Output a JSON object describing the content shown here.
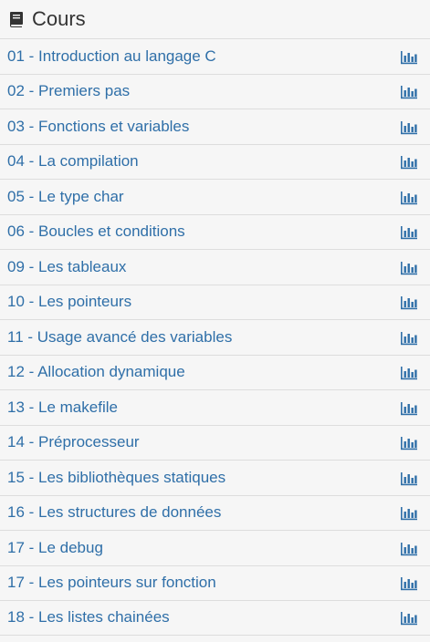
{
  "header": {
    "title": "Cours",
    "icon": "book-icon"
  },
  "colors": {
    "link": "#2f6fa8",
    "icon": "#2f6fa8",
    "title": "#333333",
    "divider": "#dddddd",
    "background": "#f6f6f6"
  },
  "items": [
    {
      "label": "01 - Introduction au langage C",
      "icon": "bar-chart-icon"
    },
    {
      "label": "02 - Premiers pas",
      "icon": "bar-chart-icon"
    },
    {
      "label": "03 - Fonctions et variables",
      "icon": "bar-chart-icon"
    },
    {
      "label": "04 - La compilation",
      "icon": "bar-chart-icon"
    },
    {
      "label": "05 - Le type char",
      "icon": "bar-chart-icon"
    },
    {
      "label": "06 - Boucles et conditions",
      "icon": "bar-chart-icon"
    },
    {
      "label": "09 - Les tableaux",
      "icon": "bar-chart-icon"
    },
    {
      "label": "10 - Les pointeurs",
      "icon": "bar-chart-icon"
    },
    {
      "label": "11 - Usage avancé des variables",
      "icon": "bar-chart-icon"
    },
    {
      "label": "12 - Allocation dynamique",
      "icon": "bar-chart-icon"
    },
    {
      "label": "13 - Le makefile",
      "icon": "bar-chart-icon"
    },
    {
      "label": "14 - Préprocesseur",
      "icon": "bar-chart-icon"
    },
    {
      "label": "15 - Les bibliothèques statiques",
      "icon": "bar-chart-icon"
    },
    {
      "label": "16 - Les structures de données",
      "icon": "bar-chart-icon"
    },
    {
      "label": "17 - Le debug",
      "icon": "bar-chart-icon"
    },
    {
      "label": "17 - Les pointeurs sur fonction",
      "icon": "bar-chart-icon"
    },
    {
      "label": "18 - Les listes chainées",
      "icon": "bar-chart-icon"
    }
  ]
}
